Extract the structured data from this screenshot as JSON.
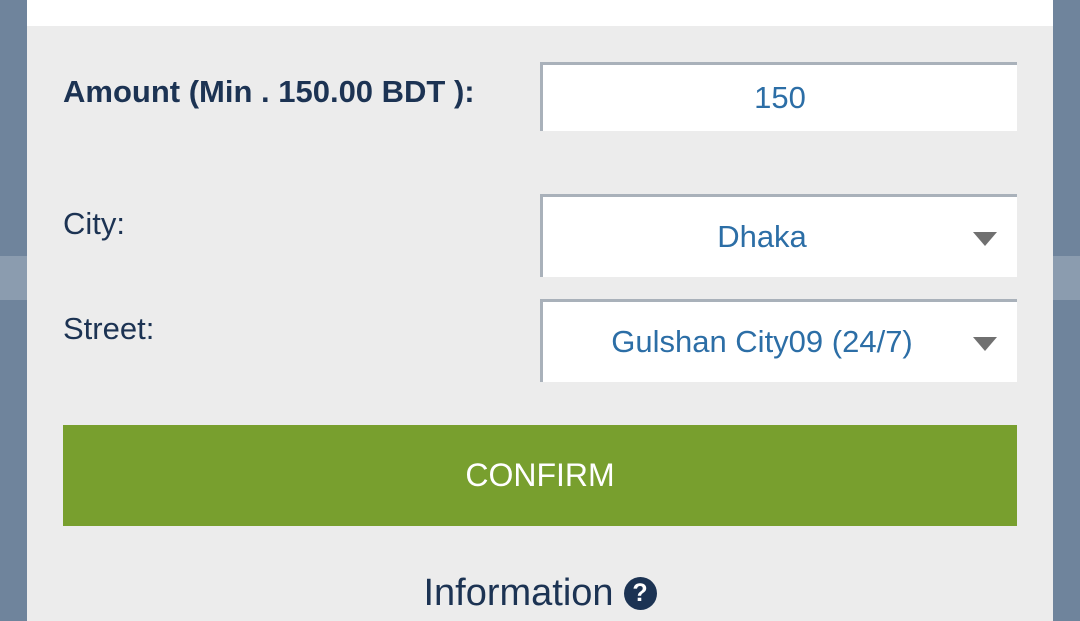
{
  "form": {
    "amount_label": "Amount (Min . 150.00 BDT ):",
    "amount_value": "150",
    "city_label": "City:",
    "city_value": "Dhaka",
    "street_label": "Street:",
    "street_value": "Gulshan City09 (24/7)"
  },
  "actions": {
    "confirm_label": "CONFIRM"
  },
  "info": {
    "label": "Information",
    "icon_glyph": "?",
    "icon": "question-circle-icon"
  },
  "colors": {
    "confirm_button": "#789f2e",
    "label_text": "#1c3353",
    "field_text": "#2c6ea6",
    "panel_bg": "#ececec",
    "page_bg": "#6f849c"
  }
}
